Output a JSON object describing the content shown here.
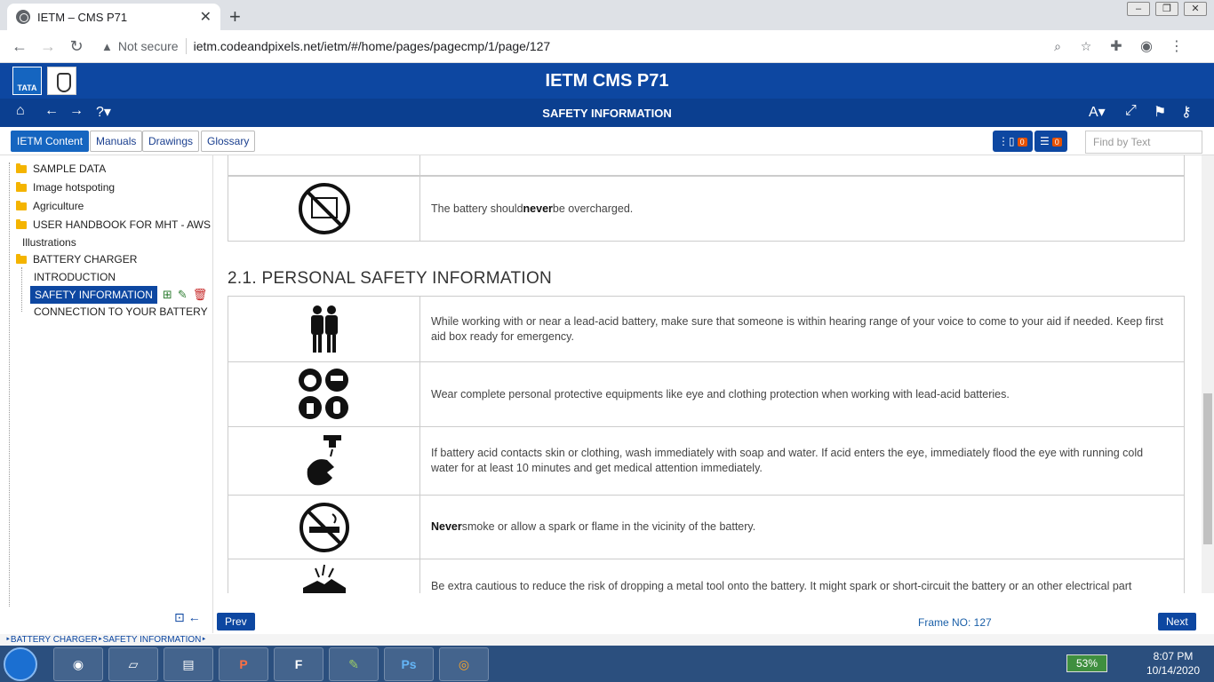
{
  "browser": {
    "tab_title": "IETM – CMS P71",
    "security": "Not secure",
    "url": "ietm.codeandpixels.net/ietm/#/home/pages/pagecmp/1/page/127"
  },
  "app": {
    "title": "IETM CMS P71",
    "subtitle": "SAFETY INFORMATION",
    "logo_text": "TATA",
    "tabs": [
      "IETM Content",
      "Manuals",
      "Drawings",
      "Glossary"
    ],
    "bookmark_count": "0",
    "comment_count": "0",
    "find_placeholder": "Find by Text"
  },
  "sidebar": {
    "items": [
      {
        "label": "SAMPLE DATA",
        "type": "folder"
      },
      {
        "label": "Image hotspoting",
        "type": "folder"
      },
      {
        "label": "Agriculture",
        "type": "folder"
      },
      {
        "label": "USER HANDBOOK FOR MHT - AWS",
        "type": "folder"
      },
      {
        "label": "Illustrations",
        "type": "leaf"
      },
      {
        "label": "BATTERY CHARGER",
        "type": "folder-open"
      },
      {
        "label": "INTRODUCTION",
        "type": "child"
      },
      {
        "label": "SAFETY INFORMATION",
        "type": "child-selected"
      },
      {
        "label": "CONNECTION TO YOUR BATTERY",
        "type": "child"
      }
    ]
  },
  "content": {
    "row_overcharge": {
      "pre": "The battery should ",
      "bold": "never",
      "post": " be overcharged."
    },
    "section_title": "2.1. PERSONAL SAFETY INFORMATION",
    "rows": [
      {
        "icon": "two-persons-icon",
        "text": "While working with or near a lead-acid battery, make sure that someone is within hearing range of your voice to come to your aid if needed. Keep first aid box ready for emergency."
      },
      {
        "icon": "ppe-equipment-icon",
        "text": "Wear complete personal protective equipments like eye and clothing protection when working with lead-acid batteries."
      },
      {
        "icon": "wash-hands-icon",
        "text": "If battery acid contacts skin or clothing, wash immediately with soap and water. If acid enters the eye, immediately flood the eye with running cold water for at least 10 minutes and get medical attention immediately."
      },
      {
        "icon": "no-smoking-icon",
        "bold": "Never",
        "text": " smoke or allow a spark or flame in the vicinity of the battery."
      },
      {
        "icon": "spark-hazard-icon",
        "text": "Be extra cautious to reduce the risk of dropping a metal tool onto the battery. It might spark or short-circuit the battery or an other electrical part"
      }
    ]
  },
  "footer": {
    "prev": "Prev",
    "next": "Next",
    "frame": "Frame NO: 127",
    "breadcrumb": "‣BATTERY CHARGER‣SAFETY INFORMATION‣"
  },
  "taskbar": {
    "apps": [
      "chrome",
      "folder",
      "explorer",
      "P",
      "F",
      "notepad",
      "Ps",
      "firefox"
    ],
    "battery": "53%",
    "time": "8:07 PM",
    "date": "10/14/2020"
  },
  "colors": {
    "header": "#0d47a1",
    "accent": "#1565c0",
    "badge": "#e65100"
  }
}
